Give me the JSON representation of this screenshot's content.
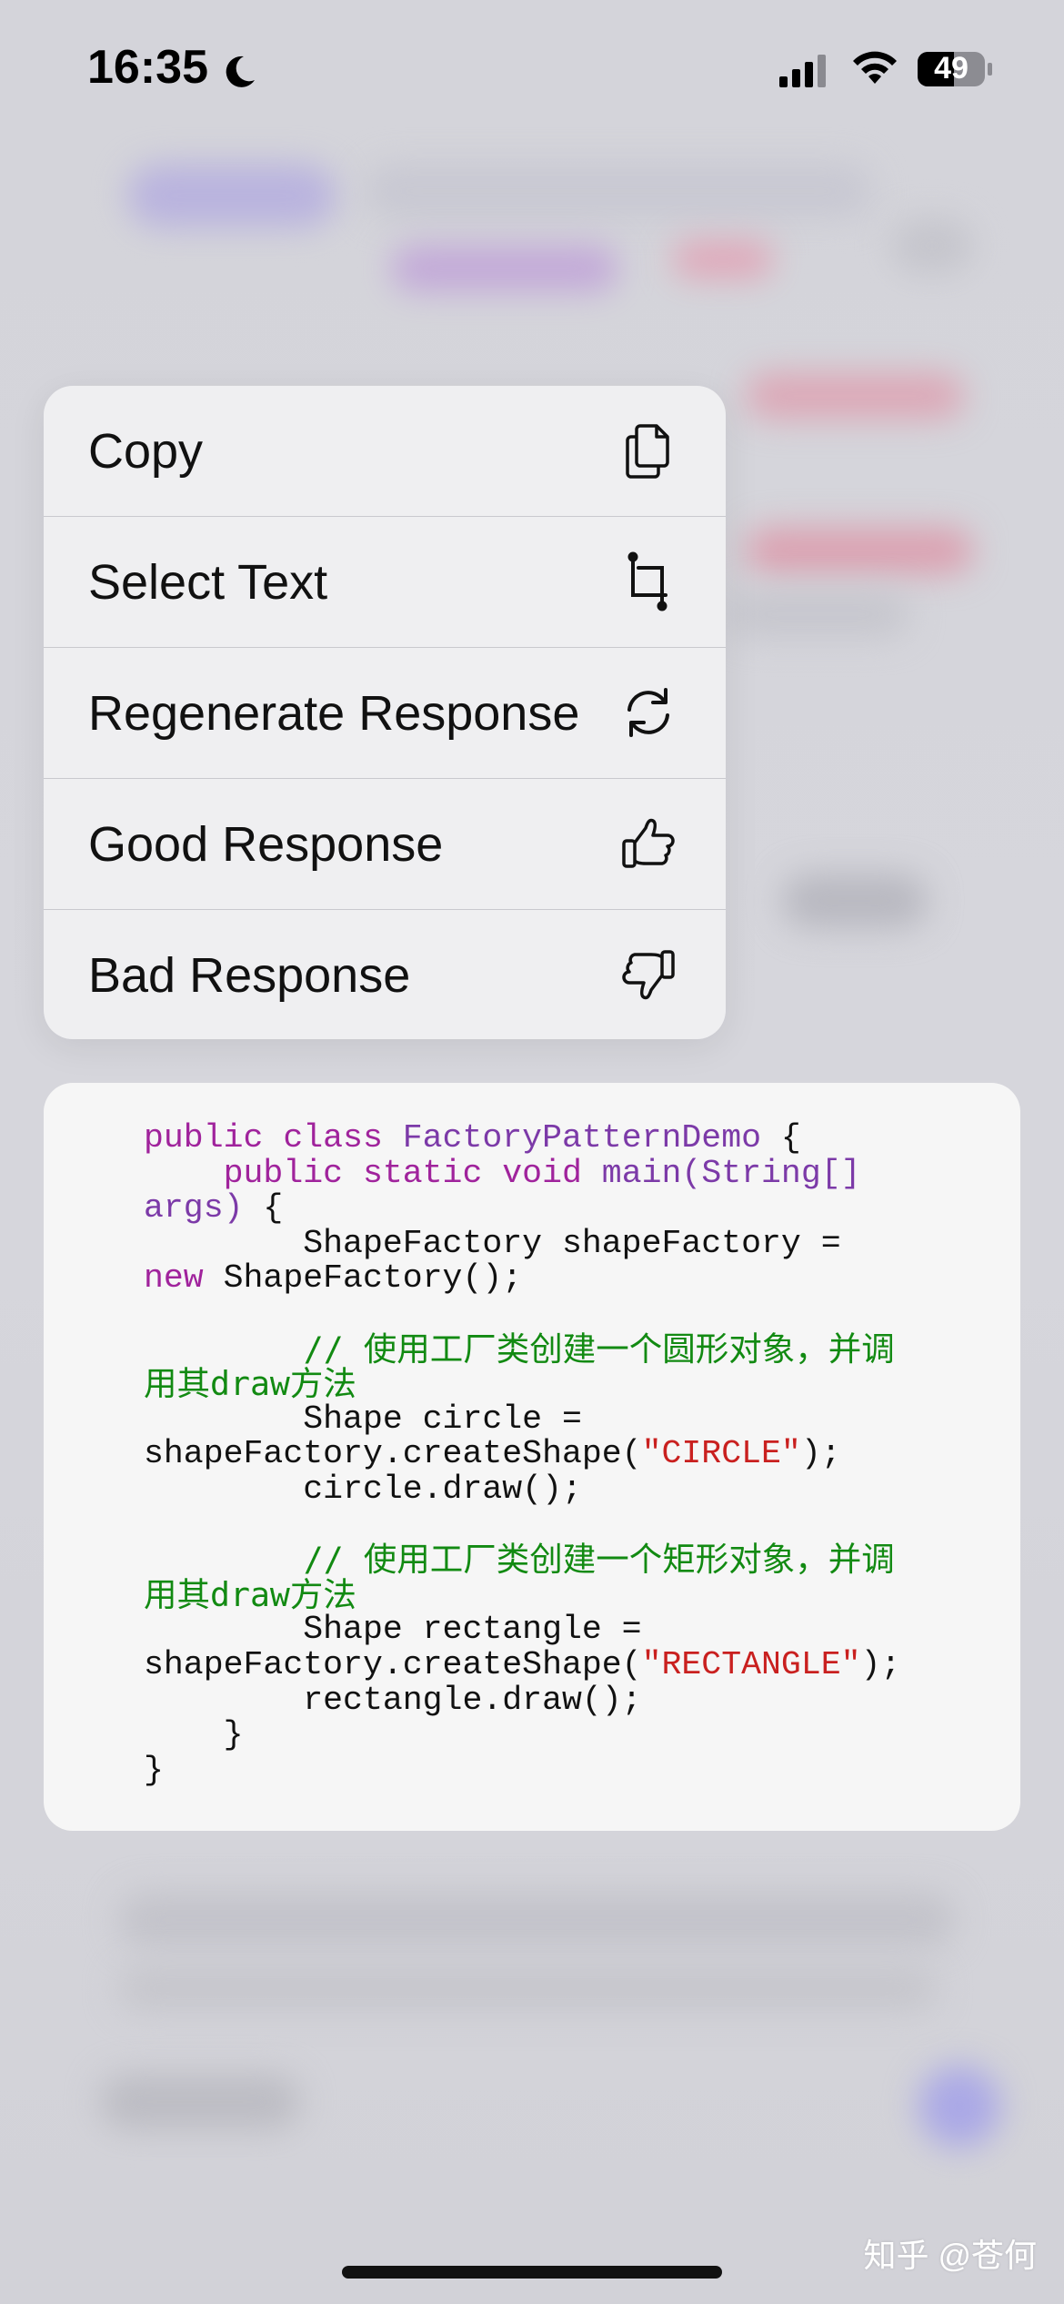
{
  "status_bar": {
    "time": "16:35",
    "battery": "49",
    "icons": [
      "moon-icon",
      "cellular-signal-icon",
      "wifi-icon",
      "battery-icon"
    ]
  },
  "menu": {
    "items": [
      {
        "label": "Copy",
        "icon": "copy-icon"
      },
      {
        "label": "Select Text",
        "icon": "crop-select-icon"
      },
      {
        "label": "Regenerate Response",
        "icon": "refresh-icon"
      },
      {
        "label": "Good Response",
        "icon": "thumbs-up-icon"
      },
      {
        "label": "Bad Response",
        "icon": "thumbs-down-icon"
      }
    ]
  },
  "code": {
    "lines": [
      [
        {
          "t": "public class ",
          "c": "kw"
        },
        {
          "t": "FactoryPatternDemo",
          "c": "cls"
        },
        {
          "t": " {",
          "c": ""
        }
      ],
      [
        {
          "t": "    public static void ",
          "c": "kw"
        },
        {
          "t": "main(String[]",
          "c": "cls"
        }
      ],
      [
        {
          "t": "args)",
          "c": "cls"
        },
        {
          "t": " {",
          "c": ""
        }
      ],
      [
        {
          "t": "        ShapeFactory shapeFactory =",
          "c": ""
        }
      ],
      [
        {
          "t": "new",
          "c": "kw"
        },
        {
          "t": " ShapeFactory();",
          "c": ""
        }
      ],
      [],
      [
        {
          "t": "        // 使用工厂类创建一个圆形对象，并调",
          "c": "cmt"
        }
      ],
      [
        {
          "t": "用其draw方法",
          "c": "cmt"
        }
      ],
      [
        {
          "t": "        Shape circle =",
          "c": ""
        }
      ],
      [
        {
          "t": "shapeFactory.createShape(",
          "c": ""
        },
        {
          "t": "\"CIRCLE\"",
          "c": "str"
        },
        {
          "t": ");",
          "c": ""
        }
      ],
      [
        {
          "t": "        circle.draw();",
          "c": ""
        }
      ],
      [],
      [
        {
          "t": "        // 使用工厂类创建一个矩形对象，并调",
          "c": "cmt"
        }
      ],
      [
        {
          "t": "用其draw方法",
          "c": "cmt"
        }
      ],
      [
        {
          "t": "        Shape rectangle =",
          "c": ""
        }
      ],
      [
        {
          "t": "shapeFactory.createShape(",
          "c": ""
        },
        {
          "t": "\"RECTANGLE\"",
          "c": "str"
        },
        {
          "t": ");",
          "c": ""
        }
      ],
      [
        {
          "t": "        rectangle.draw();",
          "c": ""
        }
      ],
      [
        {
          "t": "    }",
          "c": ""
        }
      ],
      [
        {
          "t": "}",
          "c": ""
        }
      ]
    ]
  },
  "watermark": "知乎 @苍何",
  "colors": {
    "keyword": "#a0239c",
    "class_name": "#7c3aa8",
    "string": "#c9201f",
    "comment": "#128a12",
    "menu_bg": "#efeff1",
    "code_bg": "#f6f6f6"
  }
}
